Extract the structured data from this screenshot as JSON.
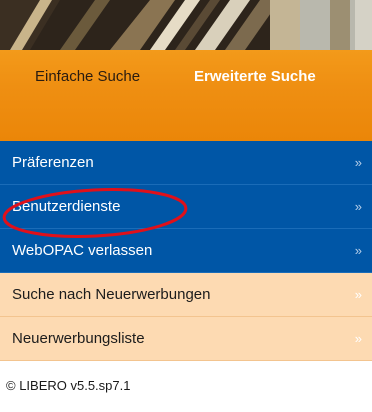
{
  "tabs": {
    "simple_search": "Einfache Suche",
    "advanced_search": "Erweiterte Suche"
  },
  "menu": {
    "items": [
      {
        "label": "Präferenzen",
        "chevron": "»"
      },
      {
        "label": "Benutzerdienste",
        "chevron": "»"
      },
      {
        "label": "WebOPAC verlassen",
        "chevron": "»"
      },
      {
        "label": "Suche nach Neuerwerbungen",
        "chevron": "»"
      },
      {
        "label": "Neuerwerbungsliste",
        "chevron": "»"
      }
    ]
  },
  "footer": {
    "version": "© LIBERO v5.5.sp7.1"
  },
  "colors": {
    "orange": "#ef8f12",
    "blue": "#0056a6",
    "peach": "#fddab2",
    "annotation": "#e0101a"
  }
}
